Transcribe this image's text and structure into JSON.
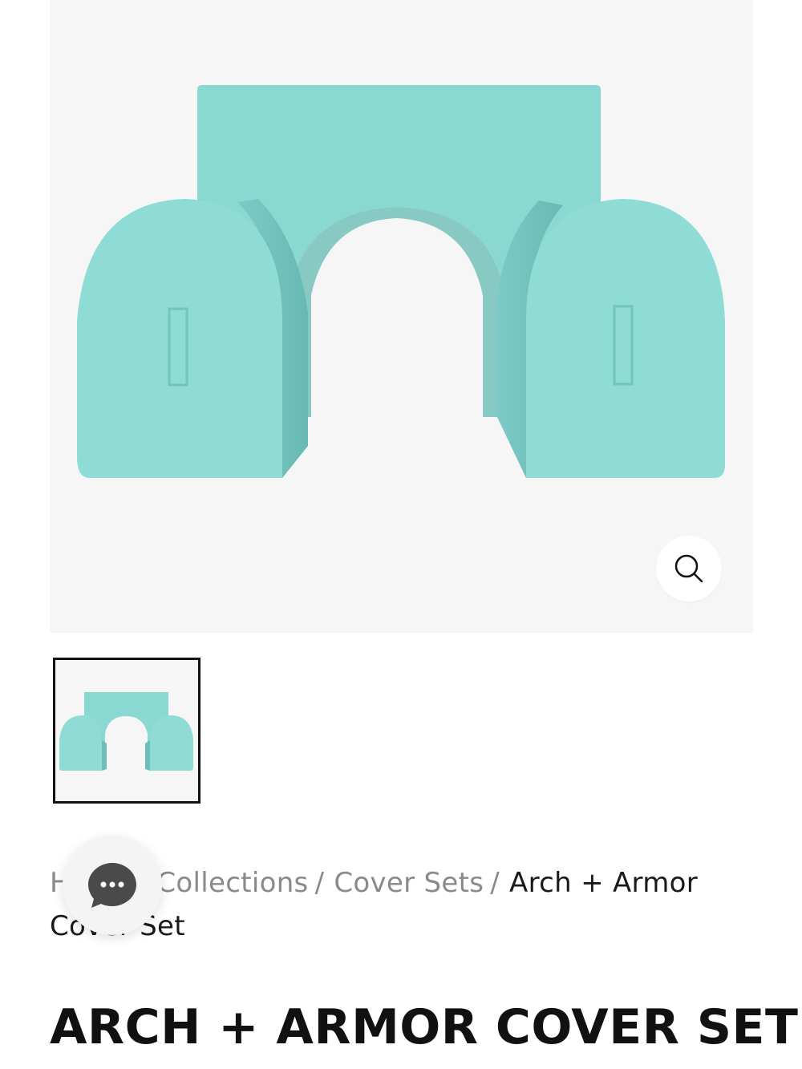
{
  "gallery": {
    "main_image_alt": "Arch + Armor Cover Set in aqua",
    "zoom_icon": "search-icon",
    "thumbnail_alt": "Arch + Armor Cover Set thumbnail",
    "product_color": "#8fdcd6"
  },
  "breadcrumb": {
    "home": "Home",
    "collections": "Collections",
    "cover_sets": "Cover Sets",
    "current": "Arch + Armor Cover Set",
    "separator": "/"
  },
  "chat": {
    "icon": "chat-bubble-icon"
  },
  "product": {
    "title": "ARCH + ARMOR COVER SET"
  }
}
